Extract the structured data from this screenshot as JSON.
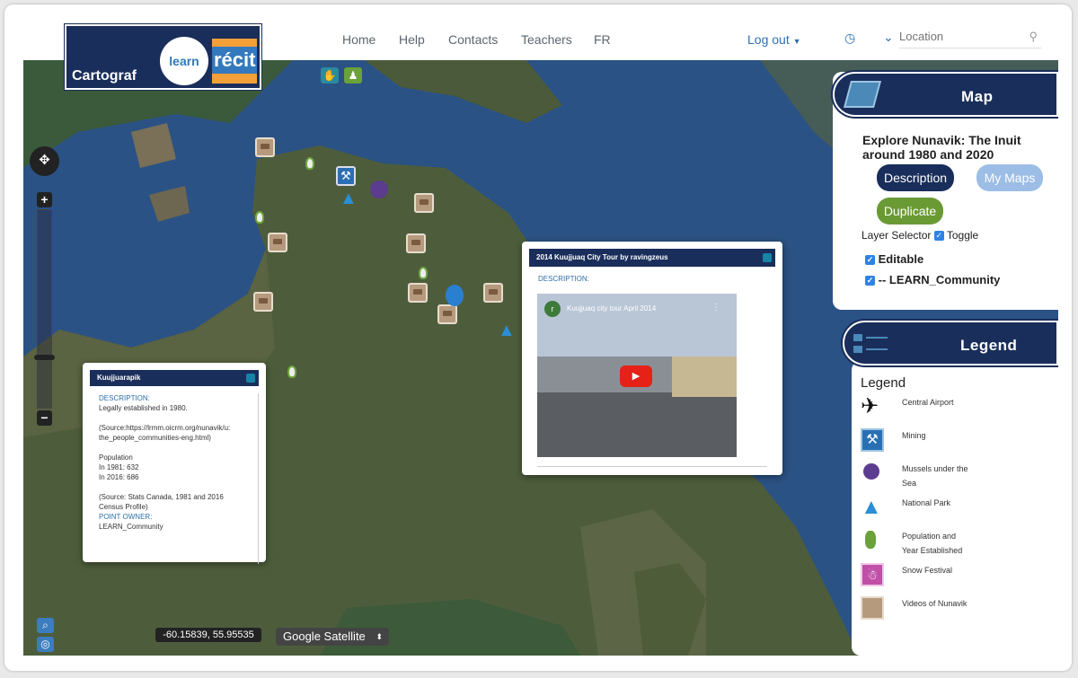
{
  "nav": {
    "home": "Home",
    "help": "Help",
    "contacts": "Contacts",
    "teachers": "Teachers",
    "fr": "FR",
    "logout": "Log out",
    "location_placeholder": "Location"
  },
  "logo": {
    "name": "Cartograf",
    "learn": "learn",
    "recit": "récit"
  },
  "map_panel": {
    "title": "Map",
    "map_title": "Explore Nunavik: The Inuit around 1980 and 2020",
    "description_btn": "Description",
    "mymaps_btn": "My Maps",
    "duplicate_btn": "Duplicate",
    "layer_selector": "Layer Selector",
    "toggle": "Toggle",
    "editable": "Editable",
    "layer_name": "-- LEARN_Community"
  },
  "legend_panel": {
    "title": "Legend",
    "heading": "Legend",
    "items": [
      {
        "label": "Central Airport",
        "icon": "airplane-icon"
      },
      {
        "label": "Mining",
        "icon": "mining-icon"
      },
      {
        "label": "Mussels under the Sea",
        "icon": "mussel-icon"
      },
      {
        "label": "National Park",
        "icon": "tent-icon"
      },
      {
        "label": "Population and Year Established",
        "icon": "person-icon"
      },
      {
        "label": "Snow Festival",
        "icon": "snowman-icon"
      },
      {
        "label": "Videos of Nunavik",
        "icon": "video-icon"
      }
    ]
  },
  "popup_kuujjuarapik": {
    "title": "Kuujjuarapik",
    "desc_label": "DESCRIPTION:",
    "line1": "Legally established in 1980.",
    "line2": "(Source:https://lrmm.oicrm.org/nunavik/u:",
    "line3": "the_people_communities-eng.html)",
    "line4": "Population",
    "line5": "In 1981: 632",
    "line6": "In 2016: 686",
    "line7": "(Source: Stats Canada, 1981 and 2016",
    "line8": "Census Profile)",
    "owner_label": "POINT OWNER:",
    "owner": "LEARN_Community"
  },
  "popup_video": {
    "title": "2014 Kuujjuaq City Tour by ravingzeus",
    "desc_label": "DESCRIPTION:",
    "video_title": "Kuujjuaq city tour April 2014",
    "channel_initial": "r"
  },
  "statusbar": {
    "coords": "-60.15839, 55.95535",
    "maptype": "Google Satellite"
  },
  "colors": {
    "navy": "#1a2e5b",
    "accent": "#2f82e3",
    "green": "#6a9a34",
    "light_blue": "#9cbde6"
  }
}
